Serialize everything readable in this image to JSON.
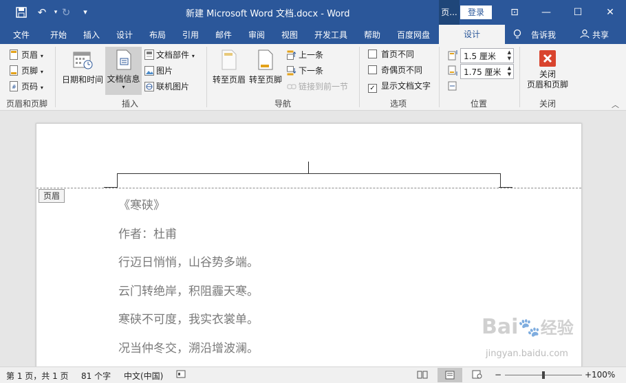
{
  "titlebar": {
    "doc_title": "新建 Microsoft Word 文档.docx  -  Word",
    "context_tab_title": "页...",
    "login": "登录",
    "qa_save": "💾",
    "qa_undo": "↶",
    "qa_redo": "↻",
    "qa_customize": "▾",
    "ribbon_display": "⊡",
    "minimize": "—",
    "maximize": "☐",
    "close": "✕"
  },
  "tabs": {
    "file": "文件",
    "home": "开始",
    "insert": "插入",
    "design": "设计",
    "layout": "布局",
    "references": "引用",
    "mailings": "邮件",
    "review": "审阅",
    "view": "视图",
    "developer": "开发工具",
    "help": "帮助",
    "baidu": "百度网盘",
    "hf_design": "设计",
    "tell_me": "告诉我",
    "share": "共享"
  },
  "ribbon": {
    "header": "页眉",
    "footer": "页脚",
    "page_number": "页码",
    "group_hf": "页眉和页脚",
    "date_time": "日期和时间",
    "doc_info": "文档信息",
    "quick_parts": "文档部件",
    "pictures": "图片",
    "online_pictures": "联机图片",
    "group_insert": "插入",
    "goto_header": "转至页眉",
    "goto_footer": "转至页脚",
    "prev": "上一条",
    "next": "下一条",
    "link_prev": "链接到前一节",
    "group_nav": "导航",
    "opt_first_page": "首页不同",
    "opt_odd_even": "奇偶页不同",
    "opt_show_text": "显示文档文字",
    "opt_first_page_checked": false,
    "opt_odd_even_checked": false,
    "opt_show_text_checked": true,
    "group_options": "选项",
    "header_pos": "1.5 厘米",
    "footer_pos": "1.75 厘米",
    "group_position": "位置",
    "close_line1": "关闭",
    "close_line2": "页眉和页脚",
    "group_close": "关闭"
  },
  "document": {
    "header_tag": "页眉",
    "lines": [
      "《寒硖》",
      "作者：杜甫",
      "行迈日悄悄，山谷势多端。",
      "云门转绝岸，积阻霾天寒。",
      "寒硖不可度，我实衣裳单。",
      "况当仲冬交，溯沿增波澜。"
    ]
  },
  "statusbar": {
    "page": "第 1 页，共 1 页",
    "words": "81 个字",
    "language": "中文(中国)",
    "zoom": "100%",
    "zoom_level": 1.0
  },
  "watermark": {
    "brand": "Bai",
    "brand_cn": "经验",
    "url": "jingyan.baidu.com"
  },
  "colors": {
    "accent": "#2b579a",
    "close_red": "#d9442e"
  }
}
